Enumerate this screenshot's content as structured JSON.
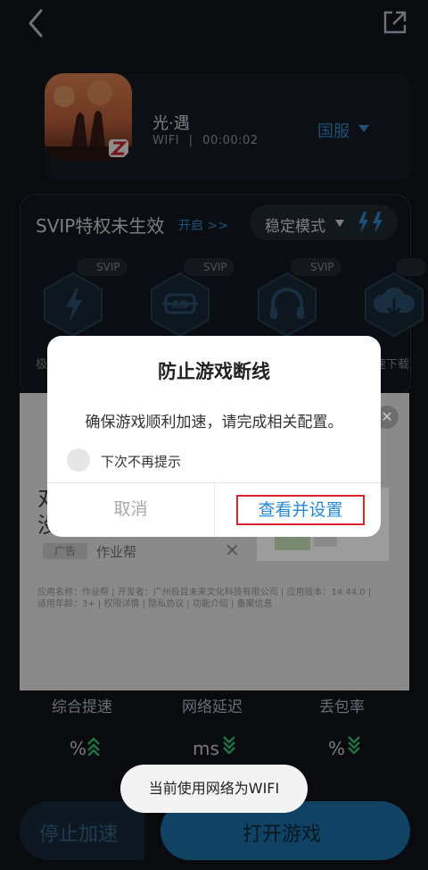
{
  "game": {
    "name": "光·遇",
    "network": "WIFI",
    "separator": "|",
    "timer": "00:00:02",
    "region": "国服"
  },
  "svip": {
    "title": "SVIP特权未生效",
    "open_link": "开启 >>",
    "mode_label": "稳定模式",
    "badge": "SVIP",
    "feature_left_text": "极",
    "feature_right_text": "速下载"
  },
  "ad": {
    "big_line1": "对",
    "big_line2": "没",
    "label": "广告",
    "brand": "作业帮",
    "close_x": "✕",
    "fine_print_1": "应用名称：作业帮 | 开发者：广州极目未来文化科技有限公司 | 应用版本：14.44.0 |",
    "fine_print_2": "适用年龄：3+ | 权限详情 | 隐私协议 | 功能介绍 | 备案信息"
  },
  "stats": {
    "labels": [
      "综合提速",
      "网络延迟",
      "丢包率"
    ],
    "values": [
      "%",
      "ms",
      "%"
    ]
  },
  "buttons": {
    "stop": "停止加速",
    "open": "打开游戏"
  },
  "toast": {
    "text": "当前使用网络为WIFI"
  },
  "dialog": {
    "title": "防止游戏断线",
    "body": "确保游戏顺利加速，请完成相关配置。",
    "checkbox_label": "下次不再提示",
    "cancel": "取消",
    "confirm": "查看并设置"
  },
  "colors": {
    "accent": "#1d78b4",
    "link": "#2f95de",
    "highlight_border": "#d9262d",
    "chevron_green": "#3ccf7a"
  }
}
